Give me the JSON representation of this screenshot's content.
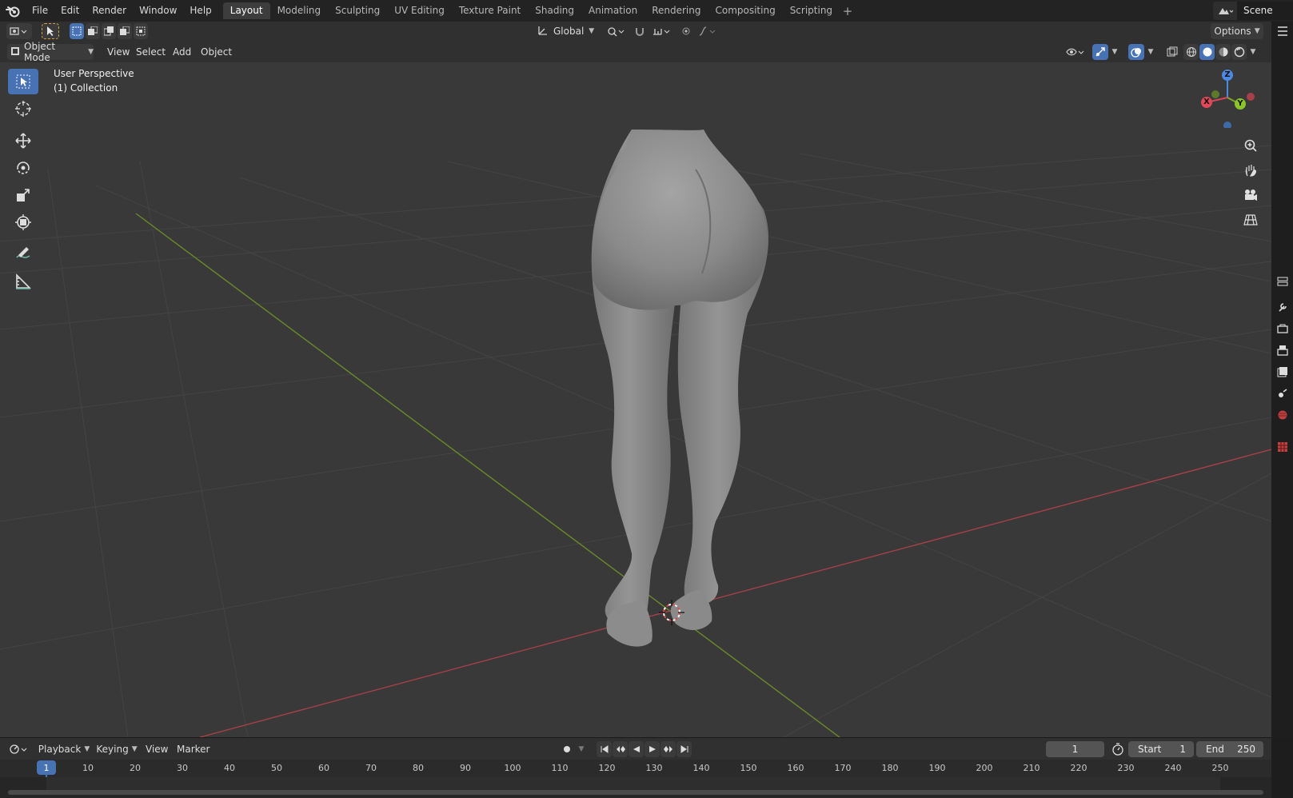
{
  "menubar": {
    "items": [
      "File",
      "Edit",
      "Render",
      "Window",
      "Help"
    ]
  },
  "workspaces": {
    "tabs": [
      "Layout",
      "Modeling",
      "Sculpting",
      "UV Editing",
      "Texture Paint",
      "Shading",
      "Animation",
      "Rendering",
      "Compositing",
      "Scripting"
    ],
    "active": "Layout",
    "add_label": "+"
  },
  "scene": {
    "name": "Scene"
  },
  "tool_header": {
    "orientation": "Global",
    "options_label": "Options"
  },
  "viewport_header": {
    "mode": "Object Mode",
    "menus": [
      "View",
      "Select",
      "Add",
      "Object"
    ]
  },
  "viewport": {
    "perspective_label": "User Perspective",
    "collection_label": "(1) Collection",
    "gizmo_axes": {
      "x": "X",
      "y": "Y",
      "z": "Z"
    },
    "colors": {
      "x_axis": "#d94658",
      "y_axis": "#7fa82d",
      "z_axis": "#4b8ae0",
      "active_tool": "#4772b3"
    }
  },
  "toolbar": {
    "tools": [
      "select-box-icon",
      "cursor-icon",
      "move-icon",
      "rotate-icon",
      "scale-icon",
      "transform-icon",
      "annotate-icon",
      "measure-icon"
    ]
  },
  "timeline": {
    "menus": [
      "Playback",
      "Keying",
      "View",
      "Marker"
    ],
    "current_frame": "1",
    "start_label": "Start",
    "start_value": "1",
    "end_label": "End",
    "end_value": "250",
    "ticks": [
      "1",
      "10",
      "20",
      "30",
      "40",
      "50",
      "60",
      "70",
      "80",
      "90",
      "100",
      "110",
      "120",
      "130",
      "140",
      "150",
      "160",
      "170",
      "180",
      "190",
      "200",
      "210",
      "220",
      "230",
      "240",
      "250"
    ]
  }
}
